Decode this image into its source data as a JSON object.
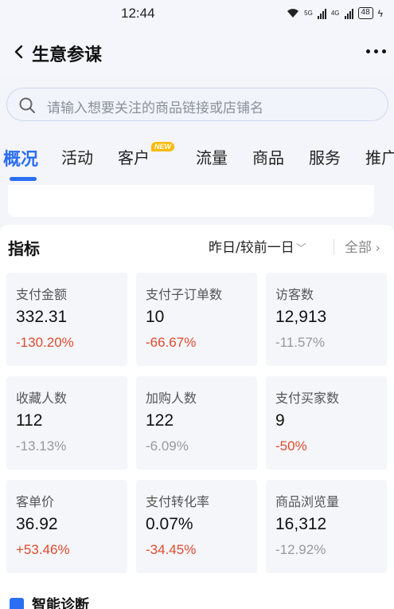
{
  "status_bar": {
    "time": "12:44",
    "network_1": "5G",
    "network_2": "4G",
    "battery": "48"
  },
  "header": {
    "title": "生意参谋",
    "back_icon": "chevron-left-icon",
    "more_icon": "more-dots-icon"
  },
  "search": {
    "placeholder": "请输入想要关注的商品链接或店铺名"
  },
  "tabs": [
    {
      "label": "概况",
      "active": true
    },
    {
      "label": "活动"
    },
    {
      "label": "客户",
      "badge": "NEW"
    },
    {
      "label": "流量"
    },
    {
      "label": "商品"
    },
    {
      "label": "服务"
    },
    {
      "label": "推广"
    }
  ],
  "metrics": {
    "title": "指标",
    "date_range": "昨日/较前一日",
    "all_label": "全部",
    "items": [
      {
        "label": "支付金额",
        "value": "332.31",
        "change": "-130.20%"
      },
      {
        "label": "支付子订单数",
        "value": "10",
        "change": "-66.67%"
      },
      {
        "label": "访客数",
        "value": "12,913",
        "change": "-11.57%"
      },
      {
        "label": "收藏人数",
        "value": "112",
        "change": "-13.13%"
      },
      {
        "label": "加购人数",
        "value": "122",
        "change": "-6.09%"
      },
      {
        "label": "支付买家数",
        "value": "9",
        "change": "-50%"
      },
      {
        "label": "客单价",
        "value": "36.92",
        "change": "+53.46%"
      },
      {
        "label": "支付转化率",
        "value": "0.07%",
        "change": "-34.45%"
      },
      {
        "label": "商品浏览量",
        "value": "16,312",
        "change": "-12.92%"
      }
    ]
  },
  "diagnosis": {
    "title": "智能诊断"
  },
  "colors": {
    "accent": "#2b6ef2",
    "negative_red": "#e04a2e",
    "neutral_gray": "#999999",
    "badge": "#ffb900"
  }
}
